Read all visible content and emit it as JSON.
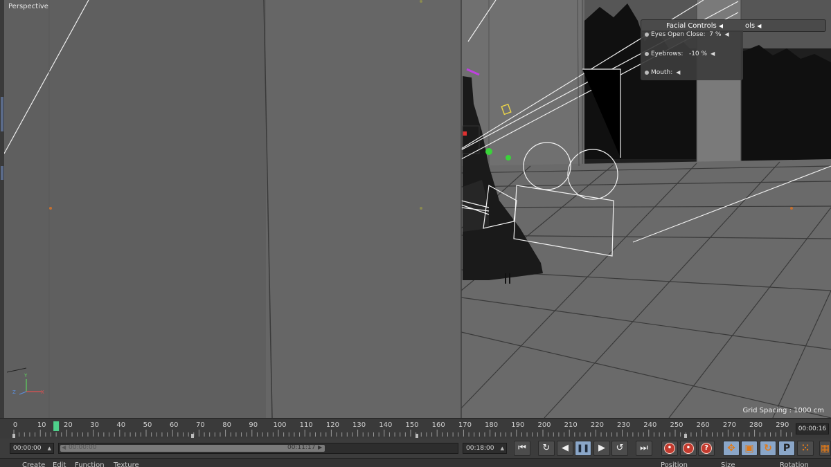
{
  "viewport": {
    "label": "Perspective",
    "grid_spacing": "Grid Spacing : 1000 cm",
    "facial_controls": {
      "title": "Facial Controls",
      "title_ghost": "ols",
      "rows": [
        {
          "label": "Eyes Open Close:",
          "value": "7 %"
        },
        {
          "label": "Eyebrows:",
          "value": "-10 %"
        },
        {
          "label": "Mouth:",
          "value": ""
        }
      ]
    },
    "axis": {
      "x": "X",
      "y": "Y",
      "z": "Z"
    }
  },
  "timeline": {
    "ticks": [
      "0",
      "10",
      "20",
      "30",
      "40",
      "50",
      "60",
      "70",
      "80",
      "90",
      "100",
      "110",
      "120",
      "130",
      "140",
      "150",
      "160",
      "170",
      "180",
      "190",
      "200",
      "210",
      "220",
      "230",
      "240",
      "250",
      "260",
      "270",
      "280",
      "290"
    ],
    "current_frame": 16,
    "current_time": "00:00:16"
  },
  "transport": {
    "start_field": "00:00:00",
    "range_start": "00:00:00",
    "range_end": "00:11:17",
    "end_field": "00:18:00",
    "buttons": {
      "first": "⏮",
      "prev_key": "↻",
      "prev_frame": "◀",
      "pause": "❚❚",
      "next_frame": "▶",
      "next_key": "↺",
      "last": "⏭"
    },
    "record_buttons": [
      "•",
      "•",
      "?"
    ],
    "tool_buttons": [
      "✥",
      "▣",
      "↻",
      "P",
      "⁙"
    ]
  },
  "bottom_menu": {
    "items": [
      "Create",
      "Edit",
      "Function",
      "Texture"
    ],
    "right_headers": [
      "Position",
      "Size",
      "Rotation"
    ]
  },
  "colors": {
    "viewport_bg": "#6b6b6b",
    "wall": "#636363",
    "panel_bg": "#3c3c3c",
    "accent_blue": "#8aa6c8",
    "record_red": "#c23a2e",
    "frame_marker": "#4ed08a"
  }
}
